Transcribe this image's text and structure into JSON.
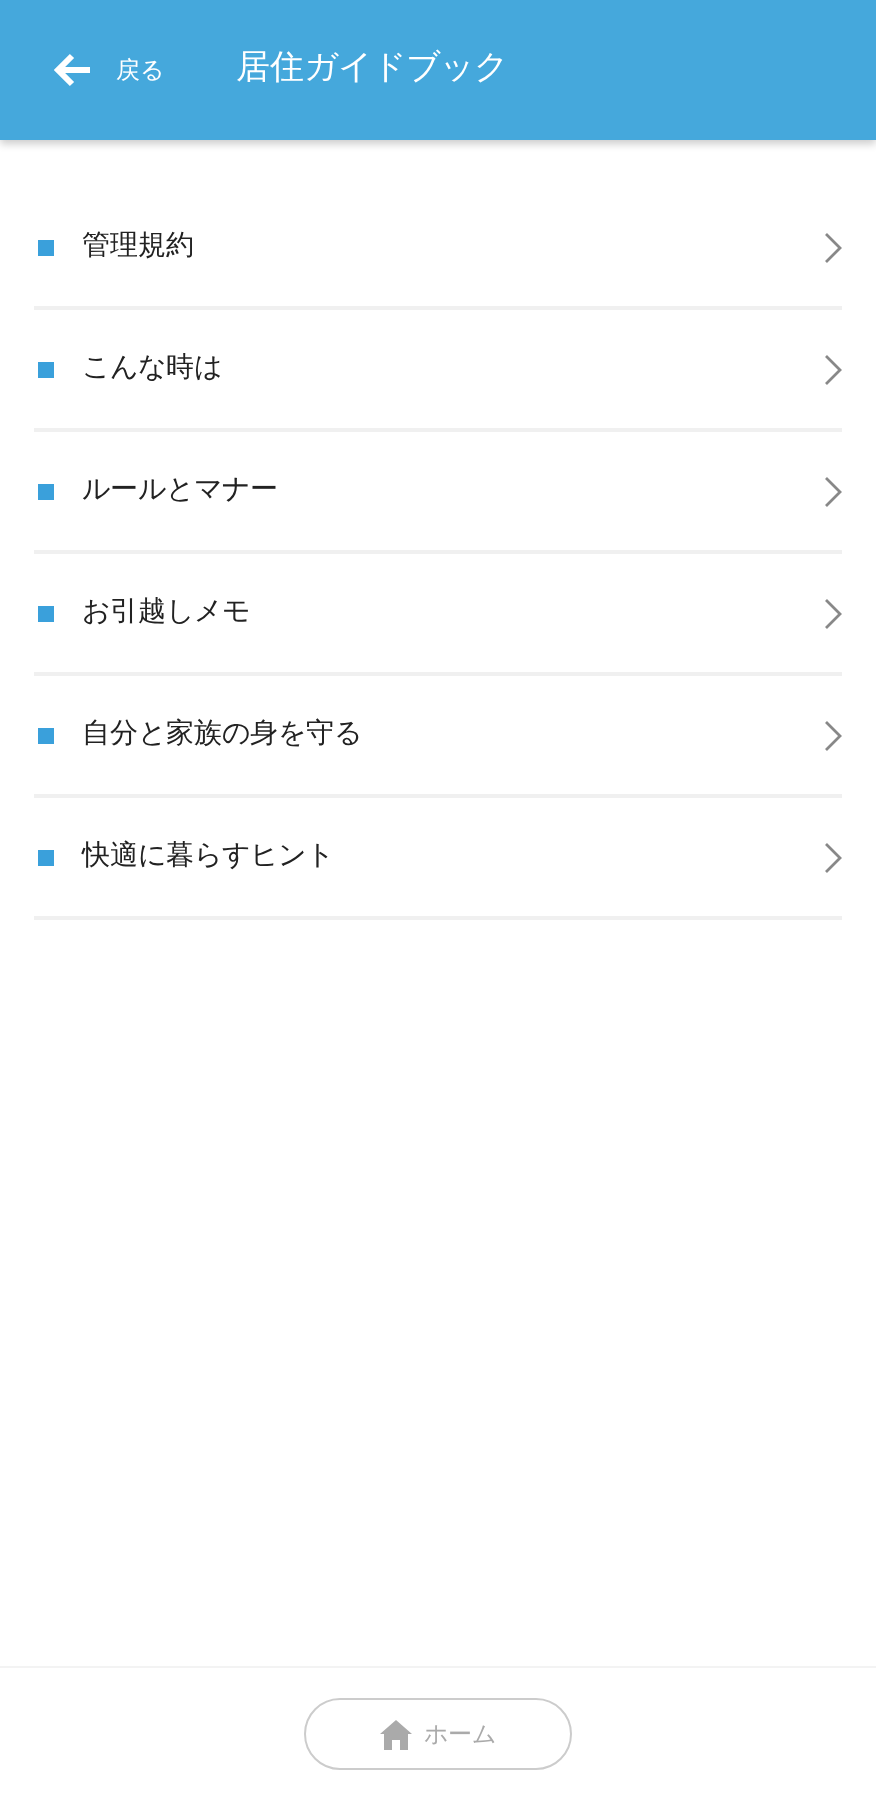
{
  "header": {
    "back_label": "戻る",
    "title": "居住ガイドブック"
  },
  "items": [
    {
      "label": "管理規約"
    },
    {
      "label": "こんな時は"
    },
    {
      "label": "ルールとマナー"
    },
    {
      "label": "お引越しメモ"
    },
    {
      "label": "自分と家族の身を守る"
    },
    {
      "label": "快適に暮らすヒント"
    }
  ],
  "footer": {
    "home_label": "ホーム",
    "disabled": true
  }
}
